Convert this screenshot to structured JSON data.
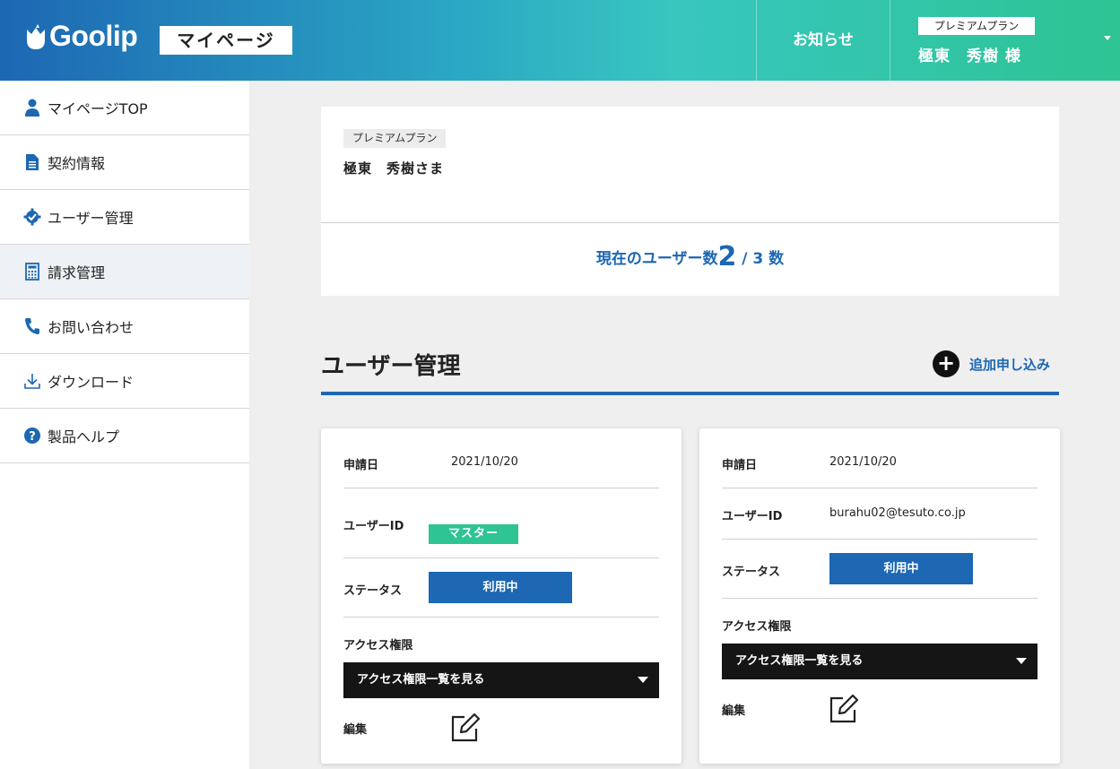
{
  "header": {
    "logo_text": "Goolip",
    "mypage_label": "マイページ",
    "news_label": "お知らせ",
    "plan_tag": "プレミアムプラン",
    "user_name": "極東　秀樹 様"
  },
  "sidebar": {
    "items": [
      {
        "label": "マイページTOP",
        "icon": "person-icon"
      },
      {
        "label": "契約情報",
        "icon": "document-icon"
      },
      {
        "label": "ユーザー管理",
        "icon": "gear-check-icon"
      },
      {
        "label": "請求管理",
        "icon": "calculator-icon",
        "active": true
      },
      {
        "label": "お問い合わせ",
        "icon": "phone-icon"
      },
      {
        "label": "ダウンロード",
        "icon": "download-icon"
      },
      {
        "label": "製品ヘルプ",
        "icon": "help-icon"
      }
    ]
  },
  "summary": {
    "plan": "プレミアムプラン",
    "name": "極東　秀樹さま",
    "count_label": "現在のユーザー数",
    "count_current": "2",
    "count_rest": " / 3 数"
  },
  "section": {
    "title": "ユーザー管理",
    "add_label": "追加申し込み"
  },
  "cards": [
    {
      "date_label": "申請日",
      "date": "2021/10/20",
      "id_label": "ユーザーID",
      "id_badge": "マスター",
      "status_label": "ステータス",
      "status": "利用中",
      "access_label": "アクセス権限",
      "access_select": "アクセス権限一覧を見る",
      "edit_label": "編集"
    },
    {
      "date_label": "申請日",
      "date": "2021/10/20",
      "id_label": "ユーザーID",
      "id_value": "burahu02@tesuto.co.jp",
      "status_label": "ステータス",
      "status": "利用中",
      "access_label": "アクセス権限",
      "access_select": "アクセス権限一覧を見る",
      "edit_label": "編集"
    }
  ],
  "colors": {
    "primary": "#1d67b3",
    "accent_green": "#2ec493",
    "dark": "#151515"
  }
}
